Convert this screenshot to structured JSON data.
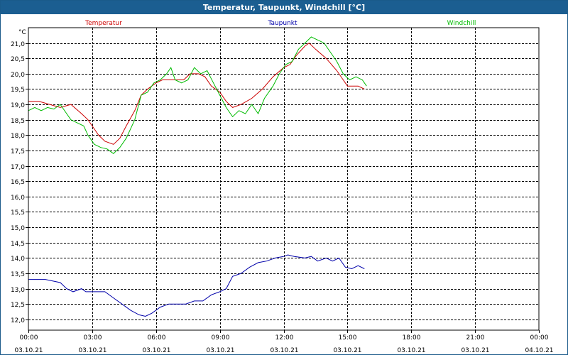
{
  "chart_data": {
    "type": "line",
    "title": "Temperatur, Taupunkt, Windchill [°C]",
    "ylabel": "°C",
    "ylim": [
      11.65,
      21.5
    ],
    "yticks": [
      "12,0",
      "12,5",
      "13,0",
      "13,5",
      "14,0",
      "14,5",
      "15,0",
      "15,5",
      "16,0",
      "16,5",
      "17,0",
      "17,5",
      "18,0",
      "18,5",
      "19,0",
      "19,5",
      "20,0",
      "20,5",
      "21,0"
    ],
    "xlim": [
      0,
      24
    ],
    "xticks": [
      {
        "time": "00:00",
        "date": "03.10.21"
      },
      {
        "time": "03:00",
        "date": "03.10.21"
      },
      {
        "time": "06:00",
        "date": "03.10.21"
      },
      {
        "time": "09:00",
        "date": "03.10.21"
      },
      {
        "time": "12:00",
        "date": "03.10.21"
      },
      {
        "time": "15:00",
        "date": "03.10.21"
      },
      {
        "time": "18:00",
        "date": "03.10.21"
      },
      {
        "time": "21:00",
        "date": "03.10.21"
      },
      {
        "time": "00:00",
        "date": "04.10.21"
      }
    ],
    "grid": true,
    "legend": "top",
    "series": [
      {
        "name": "Temperatur",
        "color": "#cc0000",
        "points": [
          [
            0,
            19.1
          ],
          [
            0.5,
            19.1
          ],
          [
            1.0,
            19.0
          ],
          [
            1.5,
            18.9
          ],
          [
            2.0,
            19.0
          ],
          [
            2.5,
            18.7
          ],
          [
            2.8,
            18.5
          ],
          [
            3.0,
            18.3
          ],
          [
            3.3,
            18.0
          ],
          [
            3.6,
            17.8
          ],
          [
            4.0,
            17.7
          ],
          [
            4.3,
            17.9
          ],
          [
            4.6,
            18.3
          ],
          [
            5.0,
            18.8
          ],
          [
            5.3,
            19.3
          ],
          [
            5.6,
            19.5
          ],
          [
            6.0,
            19.7
          ],
          [
            6.3,
            19.8
          ],
          [
            6.6,
            19.8
          ],
          [
            7.0,
            19.8
          ],
          [
            7.3,
            19.8
          ],
          [
            7.6,
            20.0
          ],
          [
            8.0,
            20.0
          ],
          [
            8.3,
            19.9
          ],
          [
            8.6,
            19.6
          ],
          [
            9.0,
            19.4
          ],
          [
            9.3,
            19.1
          ],
          [
            9.6,
            18.9
          ],
          [
            10.0,
            19.0
          ],
          [
            10.5,
            19.2
          ],
          [
            11.0,
            19.5
          ],
          [
            11.5,
            19.9
          ],
          [
            12.0,
            20.2
          ],
          [
            12.3,
            20.3
          ],
          [
            12.6,
            20.6
          ],
          [
            13.0,
            20.9
          ],
          [
            13.2,
            21.0
          ],
          [
            13.5,
            20.8
          ],
          [
            14.0,
            20.5
          ],
          [
            14.5,
            20.1
          ],
          [
            14.8,
            19.8
          ],
          [
            15.0,
            19.6
          ],
          [
            15.5,
            19.6
          ],
          [
            15.8,
            19.5
          ]
        ]
      },
      {
        "name": "Taupunkt",
        "color": "#0000aa",
        "points": [
          [
            0,
            13.3
          ],
          [
            0.8,
            13.3
          ],
          [
            1.5,
            13.2
          ],
          [
            1.8,
            13.0
          ],
          [
            2.1,
            12.9
          ],
          [
            2.5,
            13.0
          ],
          [
            2.7,
            12.9
          ],
          [
            3.0,
            12.9
          ],
          [
            3.6,
            12.9
          ],
          [
            4.0,
            12.7
          ],
          [
            4.4,
            12.5
          ],
          [
            4.8,
            12.3
          ],
          [
            5.2,
            12.15
          ],
          [
            5.5,
            12.1
          ],
          [
            5.8,
            12.2
          ],
          [
            6.2,
            12.4
          ],
          [
            6.6,
            12.5
          ],
          [
            7.0,
            12.5
          ],
          [
            7.4,
            12.5
          ],
          [
            7.8,
            12.6
          ],
          [
            8.2,
            12.6
          ],
          [
            8.6,
            12.8
          ],
          [
            9.0,
            12.9
          ],
          [
            9.3,
            13.0
          ],
          [
            9.6,
            13.4
          ],
          [
            10.0,
            13.5
          ],
          [
            10.4,
            13.7
          ],
          [
            10.8,
            13.85
          ],
          [
            11.2,
            13.9
          ],
          [
            11.6,
            14.0
          ],
          [
            12.0,
            14.05
          ],
          [
            12.2,
            14.1
          ],
          [
            12.5,
            14.05
          ],
          [
            13.0,
            14.0
          ],
          [
            13.3,
            14.05
          ],
          [
            13.6,
            13.9
          ],
          [
            14.0,
            14.0
          ],
          [
            14.3,
            13.9
          ],
          [
            14.6,
            14.0
          ],
          [
            14.9,
            13.7
          ],
          [
            15.2,
            13.65
          ],
          [
            15.5,
            13.75
          ],
          [
            15.8,
            13.65
          ]
        ]
      },
      {
        "name": "Windchill",
        "color": "#00bb00",
        "points": [
          [
            0,
            18.8
          ],
          [
            0.3,
            18.9
          ],
          [
            0.6,
            18.8
          ],
          [
            0.9,
            18.9
          ],
          [
            1.2,
            18.85
          ],
          [
            1.5,
            19.0
          ],
          [
            1.8,
            18.7
          ],
          [
            2.0,
            18.5
          ],
          [
            2.3,
            18.4
          ],
          [
            2.6,
            18.3
          ],
          [
            2.8,
            18.0
          ],
          [
            3.1,
            17.7
          ],
          [
            3.4,
            17.6
          ],
          [
            3.7,
            17.55
          ],
          [
            4.0,
            17.4
          ],
          [
            4.3,
            17.6
          ],
          [
            4.6,
            17.9
          ],
          [
            5.0,
            18.5
          ],
          [
            5.3,
            19.3
          ],
          [
            5.6,
            19.4
          ],
          [
            5.9,
            19.7
          ],
          [
            6.2,
            19.8
          ],
          [
            6.5,
            20.0
          ],
          [
            6.7,
            20.2
          ],
          [
            6.9,
            19.8
          ],
          [
            7.2,
            19.7
          ],
          [
            7.5,
            19.8
          ],
          [
            7.8,
            20.2
          ],
          [
            8.1,
            20.0
          ],
          [
            8.4,
            20.1
          ],
          [
            8.7,
            19.7
          ],
          [
            9.0,
            19.3
          ],
          [
            9.3,
            18.9
          ],
          [
            9.6,
            18.6
          ],
          [
            9.9,
            18.8
          ],
          [
            10.2,
            18.7
          ],
          [
            10.5,
            19.0
          ],
          [
            10.8,
            18.7
          ],
          [
            11.1,
            19.2
          ],
          [
            11.5,
            19.6
          ],
          [
            11.8,
            20.0
          ],
          [
            12.1,
            20.3
          ],
          [
            12.4,
            20.4
          ],
          [
            12.7,
            20.8
          ],
          [
            13.0,
            21.0
          ],
          [
            13.3,
            21.2
          ],
          [
            13.6,
            21.1
          ],
          [
            13.9,
            21.0
          ],
          [
            14.2,
            20.7
          ],
          [
            14.5,
            20.4
          ],
          [
            14.8,
            20.0
          ],
          [
            15.1,
            19.8
          ],
          [
            15.4,
            19.9
          ],
          [
            15.7,
            19.8
          ],
          [
            15.9,
            19.6
          ]
        ]
      }
    ]
  }
}
